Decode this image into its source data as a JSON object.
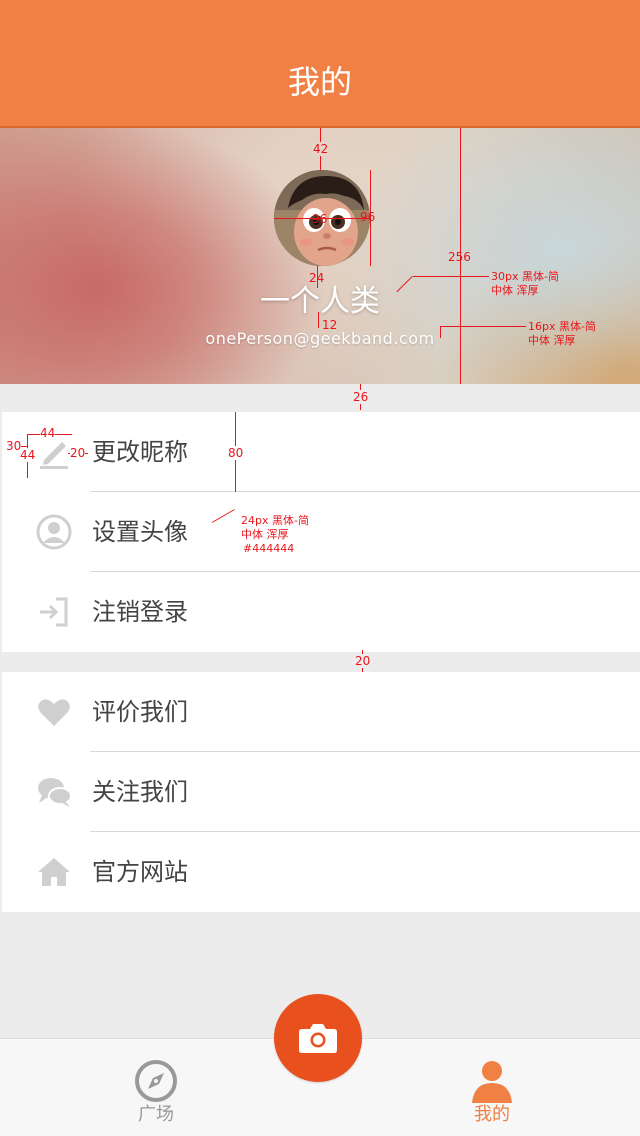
{
  "nav": {
    "title": "我的"
  },
  "profile": {
    "nickname": "一个人类",
    "email": "onePerson@geekband.com"
  },
  "annotations": {
    "avatar_top": "42",
    "avatar_width": "96",
    "avatar_height": "96",
    "header_height": "256",
    "avatar_to_name": "24",
    "name_to_email": "12",
    "nickname_spec_1": "30px 黑体-简",
    "nickname_spec_2": "中体 浑厚",
    "email_spec_1": "16px 黑体-简",
    "email_spec_2": "中体 浑厚",
    "header_to_list": "26",
    "icon_width": "44",
    "icon_height": "44",
    "icon_left": "30",
    "icon_to_text": "20",
    "row_height": "80",
    "label_spec_1": "24px 黑体-简",
    "label_spec_2": "中体 浑厚",
    "label_spec_3": "#444444",
    "group_gap": "20"
  },
  "menu_group_1": [
    {
      "label": "更改昵称",
      "icon": "pencil-icon"
    },
    {
      "label": "设置头像",
      "icon": "avatar-icon"
    },
    {
      "label": "注销登录",
      "icon": "logout-icon"
    }
  ],
  "menu_group_2": [
    {
      "label": "评价我们",
      "icon": "heart-icon"
    },
    {
      "label": "关注我们",
      "icon": "chat-bubbles-icon"
    },
    {
      "label": "官方网站",
      "icon": "house-icon"
    }
  ],
  "tabbar": {
    "square_label": "广场",
    "mine_label": "我的",
    "camera_icon": "camera-icon",
    "active_color": "#f08043",
    "inactive_color": "#999999"
  },
  "colors": {
    "brand": "#f08043",
    "camera": "#e8511e",
    "label_text": "#444444",
    "annotation": "#e8161b"
  }
}
